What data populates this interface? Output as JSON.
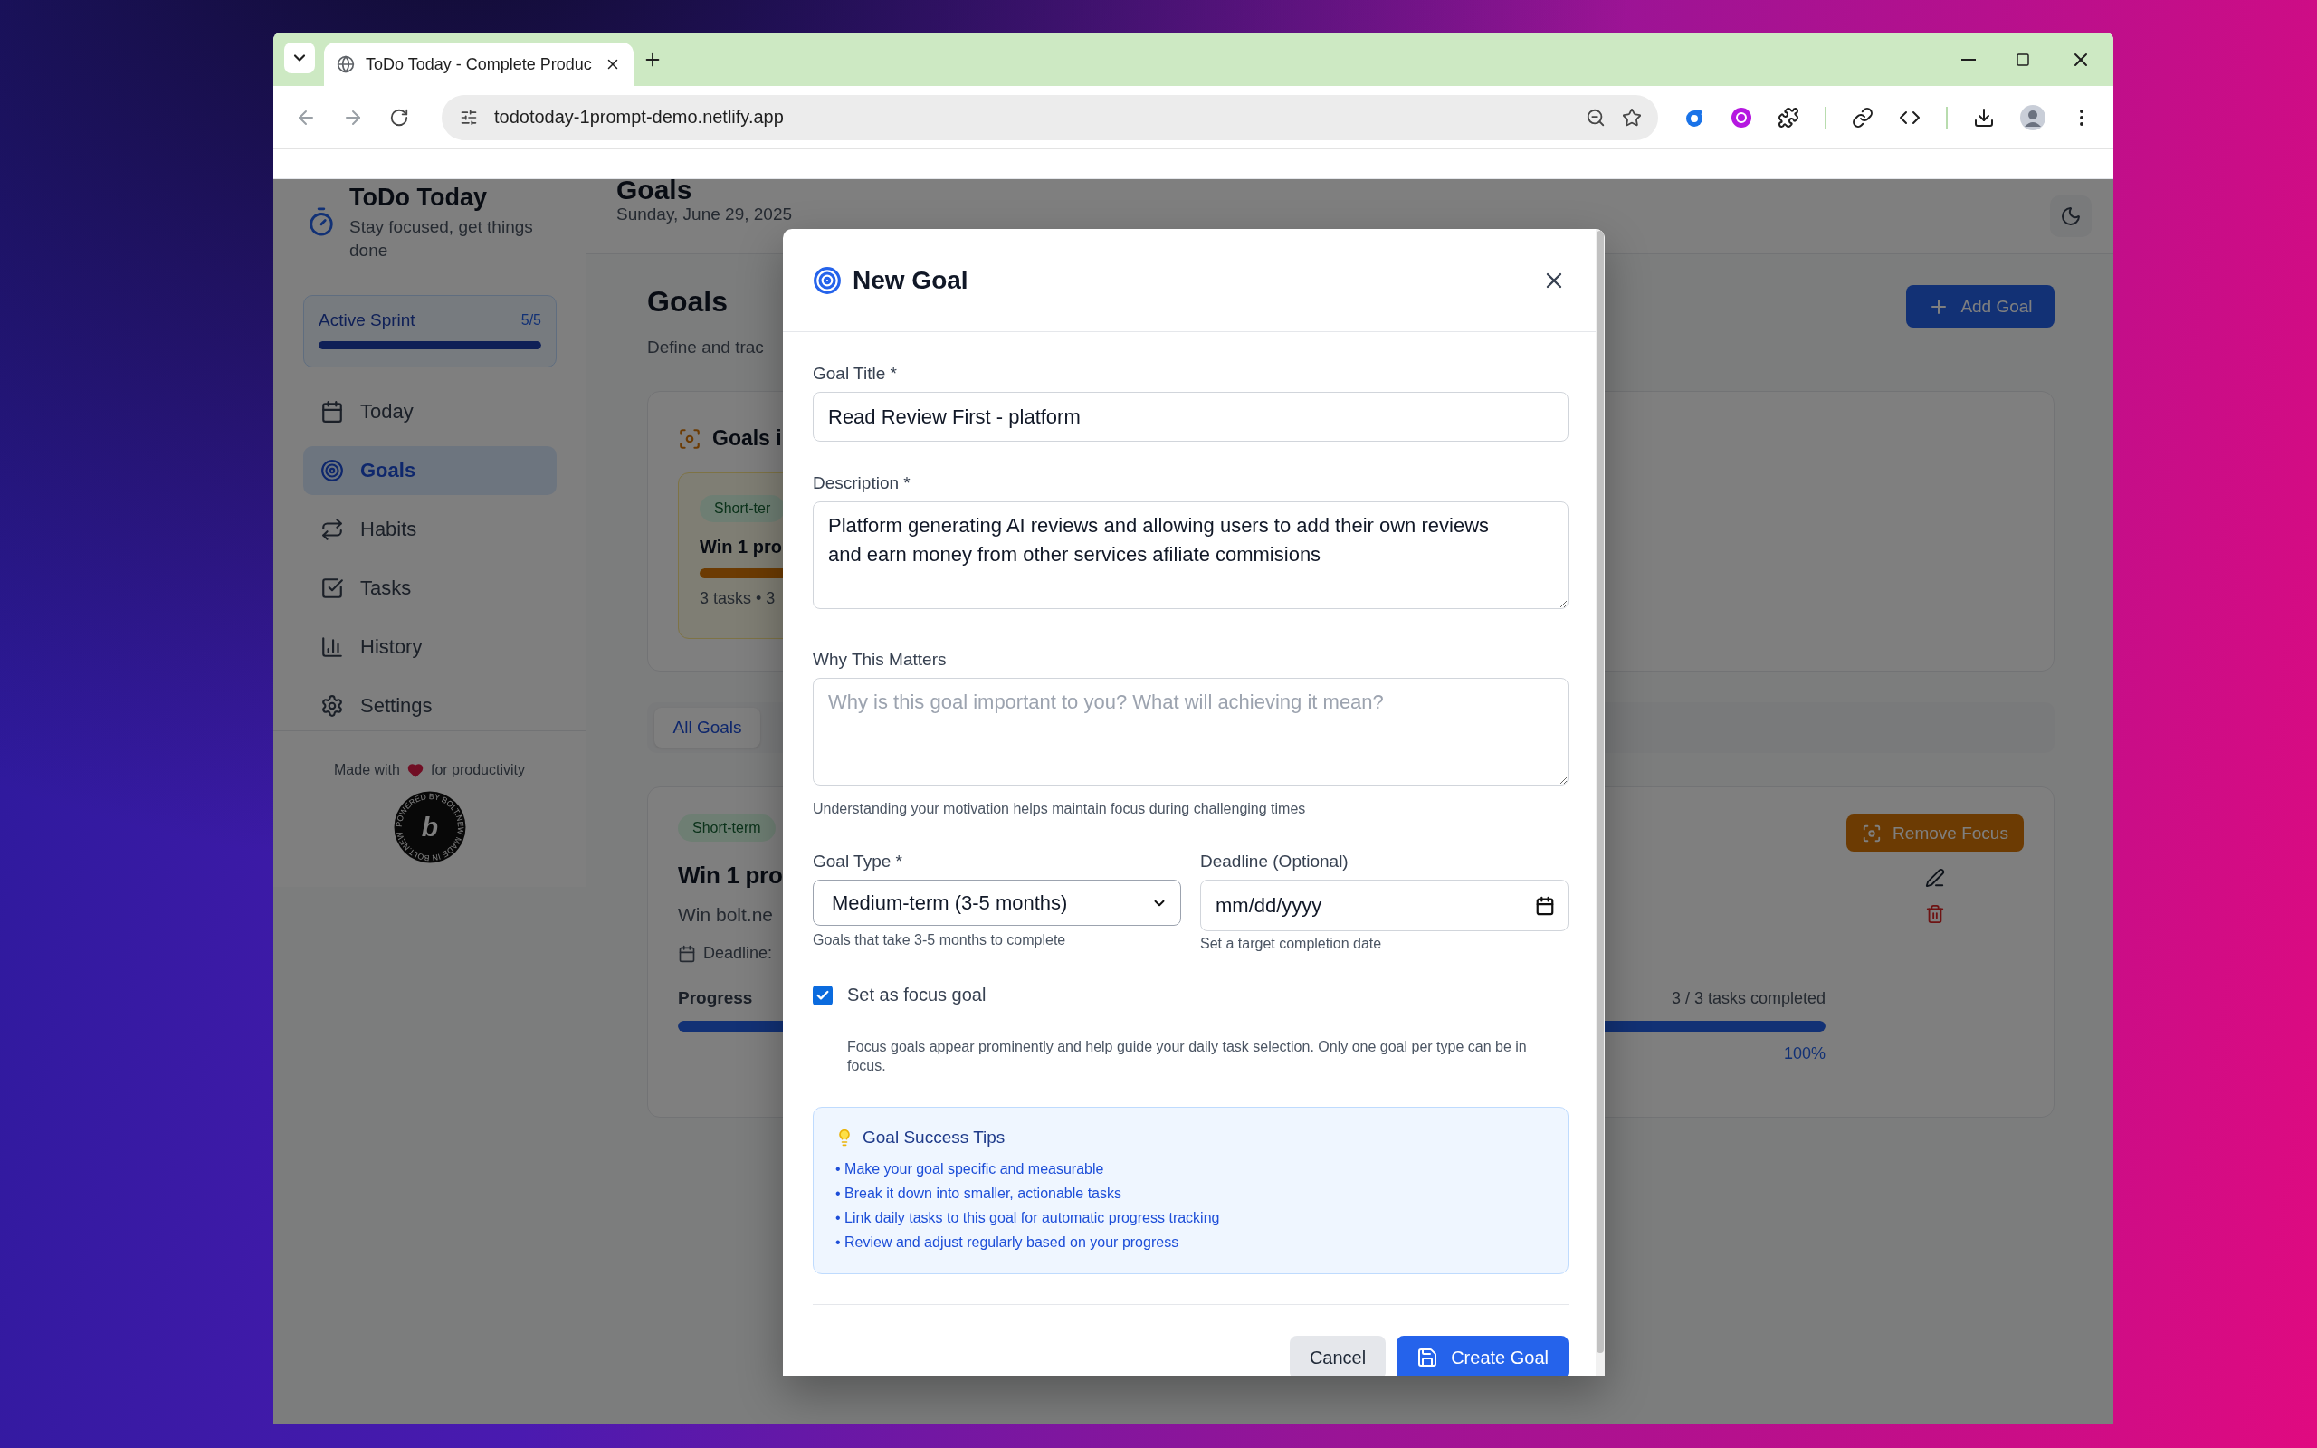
{
  "browser": {
    "tab": {
      "title": "ToDo Today - Complete Produc",
      "selected": true
    },
    "url": "todotoday-1prompt-demo.netlify.app"
  },
  "sidebar": {
    "app_name": "ToDo Today",
    "tagline": "Stay focused, get things done",
    "sprint": {
      "label": "Active Sprint",
      "count": "5/5",
      "level": 1
    },
    "nav": [
      {
        "label": "Today",
        "selected": false
      },
      {
        "label": "Goals",
        "selected": true
      },
      {
        "label": "Habits",
        "selected": false
      },
      {
        "label": "Tasks",
        "selected": false
      },
      {
        "label": "History",
        "selected": false
      },
      {
        "label": "Settings",
        "selected": false
      }
    ],
    "footer": {
      "prefix": "Made with",
      "suffix": "for productivity"
    },
    "badge": {
      "ring_text": "POWERED BY BOLT.NEW MADE IN BOLT.NEW",
      "letter": "b"
    }
  },
  "header": {
    "title": "Goals",
    "date": "Sunday, June 29, 2025"
  },
  "page": {
    "title": "Goals",
    "subtitle": "Define and trac",
    "add_button": "Add Goal",
    "focus_section": {
      "title": "Goals i",
      "card": {
        "badge": "Short-ter",
        "title": "Win 1 pro",
        "level": 1,
        "meta": "3 tasks • 3"
      }
    },
    "filters": [
      {
        "label": "All Goals",
        "selected": true
      }
    ],
    "goal": {
      "badge": "Short-term",
      "title": "Win 1 pro",
      "description": "Win bolt.ne",
      "deadline_label": "Deadline:",
      "progress_label": "Progress",
      "tasks": "3 / 3 tasks completed",
      "level": 1,
      "percent": "100%",
      "focus_button": "Remove Focus"
    }
  },
  "modal": {
    "title": "New Goal",
    "fields": [
      {
        "kind": "input",
        "label": "Goal Title *",
        "value": "Read Review First - platform"
      },
      {
        "kind": "textarea",
        "label": "Description *",
        "value": "Platform generating AI reviews and allowing users to add their own reviews and earn money from other services afiliate commisions"
      },
      {
        "kind": "textarea",
        "label": "Why This Matters",
        "placeholder": "Why is this goal important to you? What will achieving it mean?",
        "hint": "Understanding your motivation helps maintain focus during challenging times"
      }
    ],
    "row_fields": [
      {
        "kind": "select",
        "label": "Goal Type *",
        "value": "Medium-term (3-5 months)",
        "hint": "Goals that take 3-5 months to complete"
      },
      {
        "kind": "date",
        "label": "Deadline (Optional)",
        "value": "mm/dd/yyyy",
        "hint": "Set a target completion date"
      }
    ],
    "focus": {
      "label": "Set as focus goal",
      "checked": true,
      "note": "Focus goals appear prominently and help guide your daily task selection. Only one goal per type can be in focus."
    },
    "tips": {
      "title": "Goal Success Tips",
      "items": [
        "• Make your goal specific and measurable",
        "• Break it down into smaller, actionable tasks",
        "• Link daily tasks to this goal for automatic progress tracking",
        "• Review and adjust regularly based on your progress"
      ]
    },
    "buttons": [
      {
        "kind": "secondary",
        "label": "Cancel"
      },
      {
        "kind": "primary",
        "label": "Create Goal"
      }
    ]
  }
}
